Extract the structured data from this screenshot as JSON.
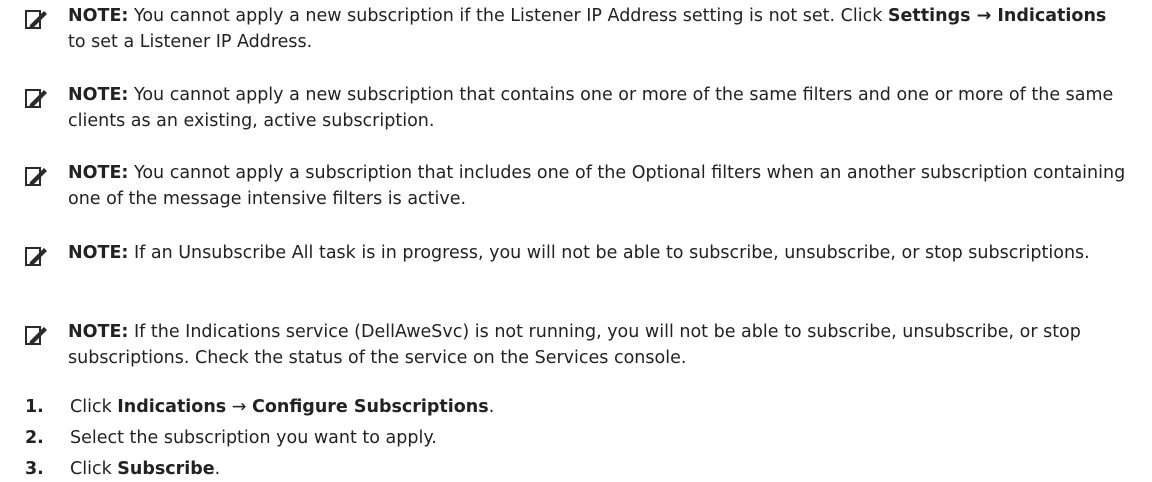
{
  "notes": [
    {
      "label": "NOTE:",
      "parts": [
        " You cannot apply a new subscription if the Listener IP Address setting is not set. Click ",
        "Settings → Indications",
        " to set a Listener IP Address."
      ]
    },
    {
      "label": "NOTE:",
      "parts": [
        " You cannot apply a new subscription that contains one or more of the same filters and one or more of the same clients as an existing, active subscription."
      ]
    },
    {
      "label": "NOTE:",
      "parts": [
        " You cannot apply a subscription that includes one of the Optional filters when an another subscription containing one of the message intensive filters is active."
      ]
    },
    {
      "label": "NOTE:",
      "parts": [
        " If an Unsubscribe All task is in progress, you will not be able to subscribe, unsubscribe, or stop subscriptions."
      ]
    },
    {
      "label": "NOTE:",
      "parts": [
        " If the Indications service (DellAweSvc) is not running, you will not be able to subscribe, unsubscribe, or stop subscriptions. Check the status of the service on the Services console."
      ]
    }
  ],
  "steps": [
    {
      "num": "1.",
      "pre": "Click ",
      "bold1": "Indications",
      "mid": " → ",
      "bold2": "Configure Subscriptions",
      "post": "."
    },
    {
      "num": "2.",
      "pre": "Select the subscription you want to apply.",
      "bold1": "",
      "mid": "",
      "bold2": "",
      "post": ""
    },
    {
      "num": "3.",
      "pre": "Click ",
      "bold1": "Subscribe",
      "mid": "",
      "bold2": "",
      "post": "."
    }
  ]
}
